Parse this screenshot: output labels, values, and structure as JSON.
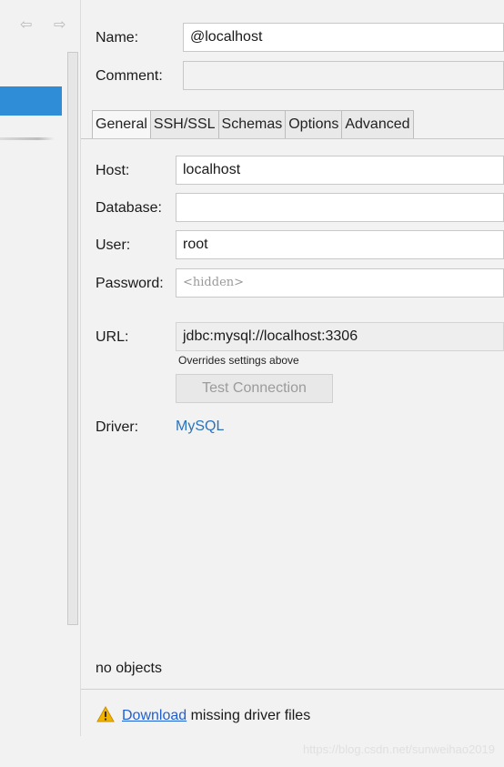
{
  "nav": {
    "back_icon": "⇦",
    "forward_icon": "⇨"
  },
  "form": {
    "name_label": "Name:",
    "name_value": "@localhost",
    "comment_label": "Comment:",
    "comment_value": ""
  },
  "tabs": [
    {
      "label": "General",
      "active": true
    },
    {
      "label": "SSH/SSL"
    },
    {
      "label": "Schemas"
    },
    {
      "label": "Options"
    },
    {
      "label": "Advanced"
    }
  ],
  "general": {
    "host_label": "Host:",
    "host_value": "localhost",
    "database_label": "Database:",
    "database_value": "",
    "user_label": "User:",
    "user_value": "root",
    "password_label": "Password:",
    "password_placeholder": "<hidden>",
    "url_label": "URL:",
    "url_value": "jdbc:mysql://localhost:3306",
    "url_note": "Overrides settings above",
    "test_connection_label": "Test Connection",
    "driver_label": "Driver:",
    "driver_value": "MySQL"
  },
  "status": {
    "objects_text": "no objects",
    "download_link": "Download",
    "missing_text": " missing driver files"
  },
  "watermark": "https://blog.csdn.net/sunweihao2019",
  "colors": {
    "selection": "#2f8dd7",
    "link": "#2a73b9",
    "warning": "#f0b400"
  }
}
